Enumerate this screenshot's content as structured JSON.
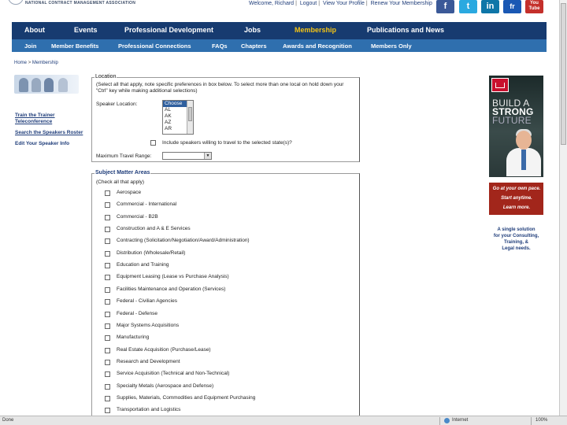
{
  "header": {
    "org_name": "NATIONAL CONTRACT MANAGEMENT ASSOCIATION",
    "utility_links": [
      "Welcome, Richard",
      "Logout",
      "View Your Profile",
      "Renew Your Membership"
    ],
    "social": [
      "f",
      "t",
      "in",
      "fr",
      "You Tube"
    ]
  },
  "nav_primary": [
    {
      "label": "About"
    },
    {
      "label": "Events"
    },
    {
      "label": "Professional Development"
    },
    {
      "label": "Jobs"
    },
    {
      "label": "Membership",
      "active": true
    },
    {
      "label": "Publications and News"
    }
  ],
  "nav_secondary": [
    "Join",
    "Member Benefits",
    "Professional Connections",
    "FAQs",
    "Chapters",
    "Awards and Recognition",
    "Members Only"
  ],
  "breadcrumb": [
    "Home",
    "Membership"
  ],
  "sidebar": {
    "links": [
      "Train the Trainer Teleconference",
      "Search the Speakers Roster",
      "Edit Your Speaker Info"
    ]
  },
  "location": {
    "legend": "Location",
    "instructions": "(Select all that apply, note specific preferences in box below. To select more than one local on hold down your \"Ctrl\" key while making additional selections)",
    "speaker_location_label": "Speaker Location:",
    "options": [
      "Choose",
      "AL",
      "AK",
      "AZ",
      "AR"
    ],
    "selected_option": "Choose",
    "travel_label": "Include speakers willing to travel to the selected state(s)?",
    "max_travel_label": "Maximum Travel Range:",
    "max_travel_value": ""
  },
  "subjects": {
    "legend": "Subject Matter Areas",
    "check_all": "(Check all that apply)",
    "items": [
      "Aerospace",
      "Commercial - International",
      "Commercial - B2B",
      "Construction and A & E Services",
      "Contracting (Solicitation/Negotiation/Award/Administration)",
      "Distribution (Wholesale/Retail)",
      "Education and Training",
      "Equipment Leasing (Lease vs Purchase Analysis)",
      "Facilities Maintenance and Operation (Services)",
      "Federal - Civilian Agencies",
      "Federal - Defense",
      "Major Systems Acquisitions",
      "Manufacturing",
      "Real Estate Acquisition (Purchase/Lease)",
      "Research and Development",
      "Service Acquisition (Technical and Non-Technical)",
      "Specialty Metals (Aerospace and Defense)",
      "Supplies, Materials, Commodities and Equipment Purchasing",
      "Transportation and Logistics"
    ]
  },
  "ads": {
    "army_lines": [
      "BUILD A",
      "STRONG",
      "FUTURE"
    ],
    "red_lines": [
      "Go at your own pace.",
      "Start anytime.",
      "Learn more."
    ],
    "blue_lines": [
      "A single solution",
      "for your Consulting,",
      "Training, &",
      "Legal needs."
    ]
  },
  "statusbar": {
    "left": "Done",
    "zone": "Internet",
    "zoom": "100%"
  }
}
